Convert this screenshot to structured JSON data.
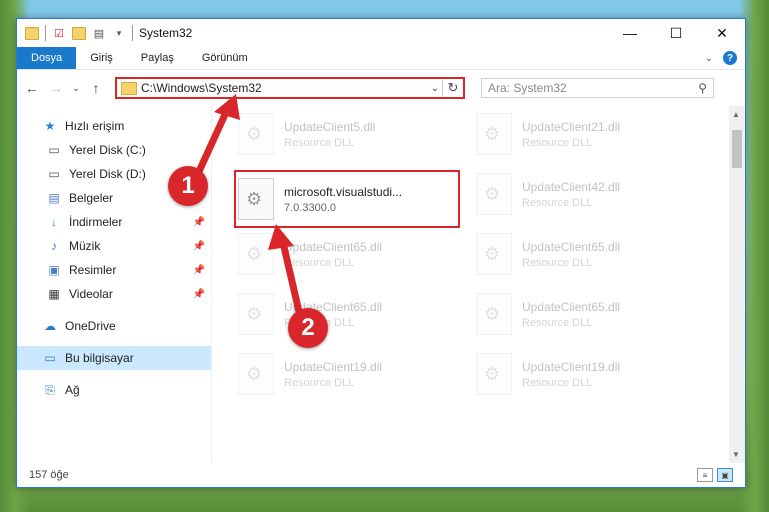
{
  "window": {
    "title": "System32",
    "controls": {
      "minimize": "—",
      "maximize": "☐",
      "close": "✕"
    }
  },
  "ribbon": {
    "tabs": [
      "Dosya",
      "Giriş",
      "Paylaş",
      "Görünüm"
    ],
    "help": "?"
  },
  "address_bar": {
    "path": "C:\\Windows\\System32",
    "search_placeholder": "Ara: System32"
  },
  "nav_pane": {
    "items": [
      {
        "label": "Hızlı erişim",
        "icon": "star-icon"
      },
      {
        "label": "Yerel Disk (C:)",
        "icon": "drive-icon"
      },
      {
        "label": "Yerel Disk (D:)",
        "icon": "drive-icon"
      },
      {
        "label": "Belgeler",
        "icon": "documents-icon"
      },
      {
        "label": "İndirmeler",
        "icon": "download-icon",
        "pinned": true
      },
      {
        "label": "Müzik",
        "icon": "music-icon",
        "pinned": true
      },
      {
        "label": "Resimler",
        "icon": "pictures-icon",
        "pinned": true
      },
      {
        "label": "Videolar",
        "icon": "video-icon",
        "pinned": true
      },
      {
        "label": "OneDrive",
        "icon": "cloud-icon"
      },
      {
        "label": "Bu bilgisayar",
        "icon": "computer-icon",
        "selected": true
      },
      {
        "label": "Ağ",
        "icon": "network-icon"
      }
    ]
  },
  "files": [
    {
      "name": "UpdateClient5.dll",
      "type": "Resource DLL",
      "faded": true
    },
    {
      "name": "UpdateClient21.dll",
      "type": "Resource DLL",
      "faded": true
    },
    {
      "name": "microsoft.visualstudi...",
      "type": "7.0.3300.0",
      "faded": false,
      "highlighted": true
    },
    {
      "name": "UpdateClient42.dll",
      "type": "Resource DLL",
      "faded": true
    },
    {
      "name": "UpdateClient65.dll",
      "type": "Resource DLL",
      "faded": true
    },
    {
      "name": "UpdateClient65.dll",
      "type": "Resource DLL",
      "faded": true
    },
    {
      "name": "UpdateClient65.dll",
      "type": "Resource DLL",
      "faded": true
    },
    {
      "name": "UpdateClient65.dll",
      "type": "Resource DLL",
      "faded": true
    },
    {
      "name": "UpdateClient19.dll",
      "type": "Resource DLL",
      "faded": true
    },
    {
      "name": "UpdateClient19.dll",
      "type": "Resource DLL",
      "faded": true
    }
  ],
  "status": {
    "count": "157 öğe"
  },
  "callouts": {
    "one": "1",
    "two": "2"
  },
  "colors": {
    "accent": "#1979ca",
    "highlight": "#d9262b",
    "selected": "#cce8ff"
  }
}
